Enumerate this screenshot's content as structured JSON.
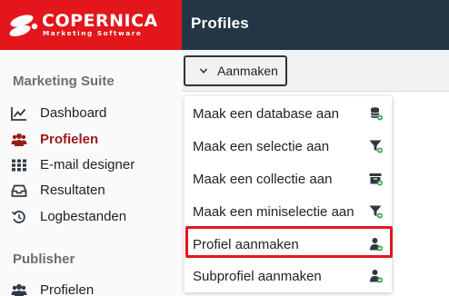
{
  "header": {
    "logo_name": "COPERNICA",
    "logo_tagline": "Marketing Software",
    "page_title": "Profiles"
  },
  "sidebar": {
    "sections": [
      {
        "title": "Marketing Suite",
        "items": [
          {
            "label": "Dashboard",
            "icon": "chart-line-icon",
            "active": false
          },
          {
            "label": "Profielen",
            "icon": "users-icon",
            "active": true
          },
          {
            "label": "E-mail designer",
            "icon": "grid-icon",
            "active": false
          },
          {
            "label": "Resultaten",
            "icon": "inbox-icon",
            "active": false
          },
          {
            "label": "Logbestanden",
            "icon": "history-icon",
            "active": false
          }
        ]
      },
      {
        "title": "Publisher",
        "items": [
          {
            "label": "Profielen",
            "icon": "users-icon",
            "active": false
          }
        ]
      }
    ]
  },
  "toolbar": {
    "create_label": "Aanmaken"
  },
  "dropdown": {
    "items": [
      {
        "label": "Maak een database aan",
        "icon": "database-add-icon"
      },
      {
        "label": "Maak een selectie aan",
        "icon": "filter-add-icon"
      },
      {
        "label": "Maak een collectie aan",
        "icon": "collection-add-icon"
      },
      {
        "label": "Maak een miniselectie aan",
        "icon": "filter-add-icon"
      },
      {
        "label": "Profiel aanmaken",
        "icon": "user-add-icon"
      },
      {
        "label": "Subprofiel aanmaken",
        "icon": "user-add-icon"
      }
    ],
    "highlighted_index": 4
  },
  "colors": {
    "brand_red": "#e3161c",
    "header_dark": "#243645",
    "active_nav": "#9b1b1b",
    "icon_gray": "#2f3a45",
    "add_badge_green": "#3aa04a"
  }
}
